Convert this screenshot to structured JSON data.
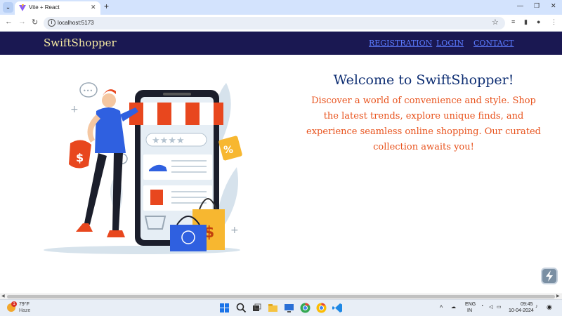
{
  "browser": {
    "tab_title": "Vite + React",
    "url": "localhost:5173"
  },
  "site": {
    "brand": "SwiftShopper",
    "nav": [
      "REGISTRATION",
      "LOGIN",
      "CONTACT"
    ]
  },
  "hero": {
    "title": "Welcome to SwiftShopper!",
    "description": "Discover a world of convenience and style. Shop the latest trends, explore unique finds, and experience seamless online shopping. Our curated collection awaits you!"
  },
  "taskbar": {
    "weather_temp": "79°F",
    "weather_condition": "Haze",
    "notification_badge": "1",
    "language": "ENG",
    "region": "IN",
    "time": "09:45",
    "date": "10-04-2024"
  },
  "colors": {
    "nav_bg": "#1a1852",
    "brand": "#f5eaa2",
    "nav_link": "#5b7bff",
    "title": "#0f2f73",
    "description": "#e8521c"
  },
  "icons": [
    "vite-icon",
    "info-icon",
    "star-icon",
    "windows-start-icon",
    "search-icon",
    "file-explorer-icon",
    "chrome-icon",
    "vscode-icon",
    "swiftshopper-float-icon"
  ]
}
